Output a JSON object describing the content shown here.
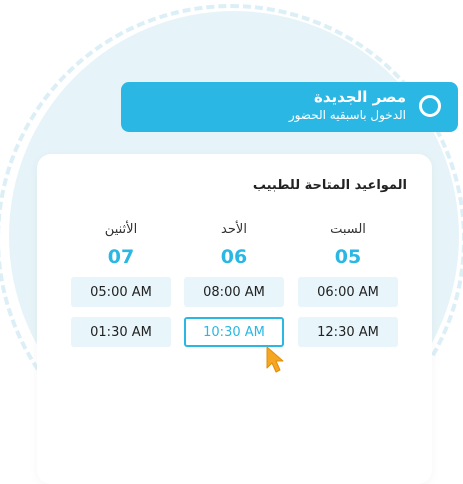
{
  "location": {
    "title": "مصر الجديدة",
    "subtitle": "الدخول باسبقيه الحضور"
  },
  "schedule": {
    "title": "المواعيد المتاحة للطبيب",
    "days": [
      {
        "name": "السبت",
        "number": "05",
        "slots": [
          "06:00 AM",
          "12:30 AM"
        ]
      },
      {
        "name": "الأحد",
        "number": "06",
        "slots": [
          "08:00 AM",
          "10:30 AM"
        ]
      },
      {
        "name": "الأثنين",
        "number": "07",
        "slots": [
          "05:00 AM",
          "01:30 AM"
        ]
      }
    ],
    "selected_slot": "10:30 AM"
  },
  "colors": {
    "accent": "#2bb7e3",
    "slot_bg": "#e8f5fb",
    "background_circle": "#e6f4f9",
    "cursor": "#f5a623"
  },
  "icons": {
    "radio": "radio-icon",
    "cursor": "mouse-pointer-icon"
  }
}
